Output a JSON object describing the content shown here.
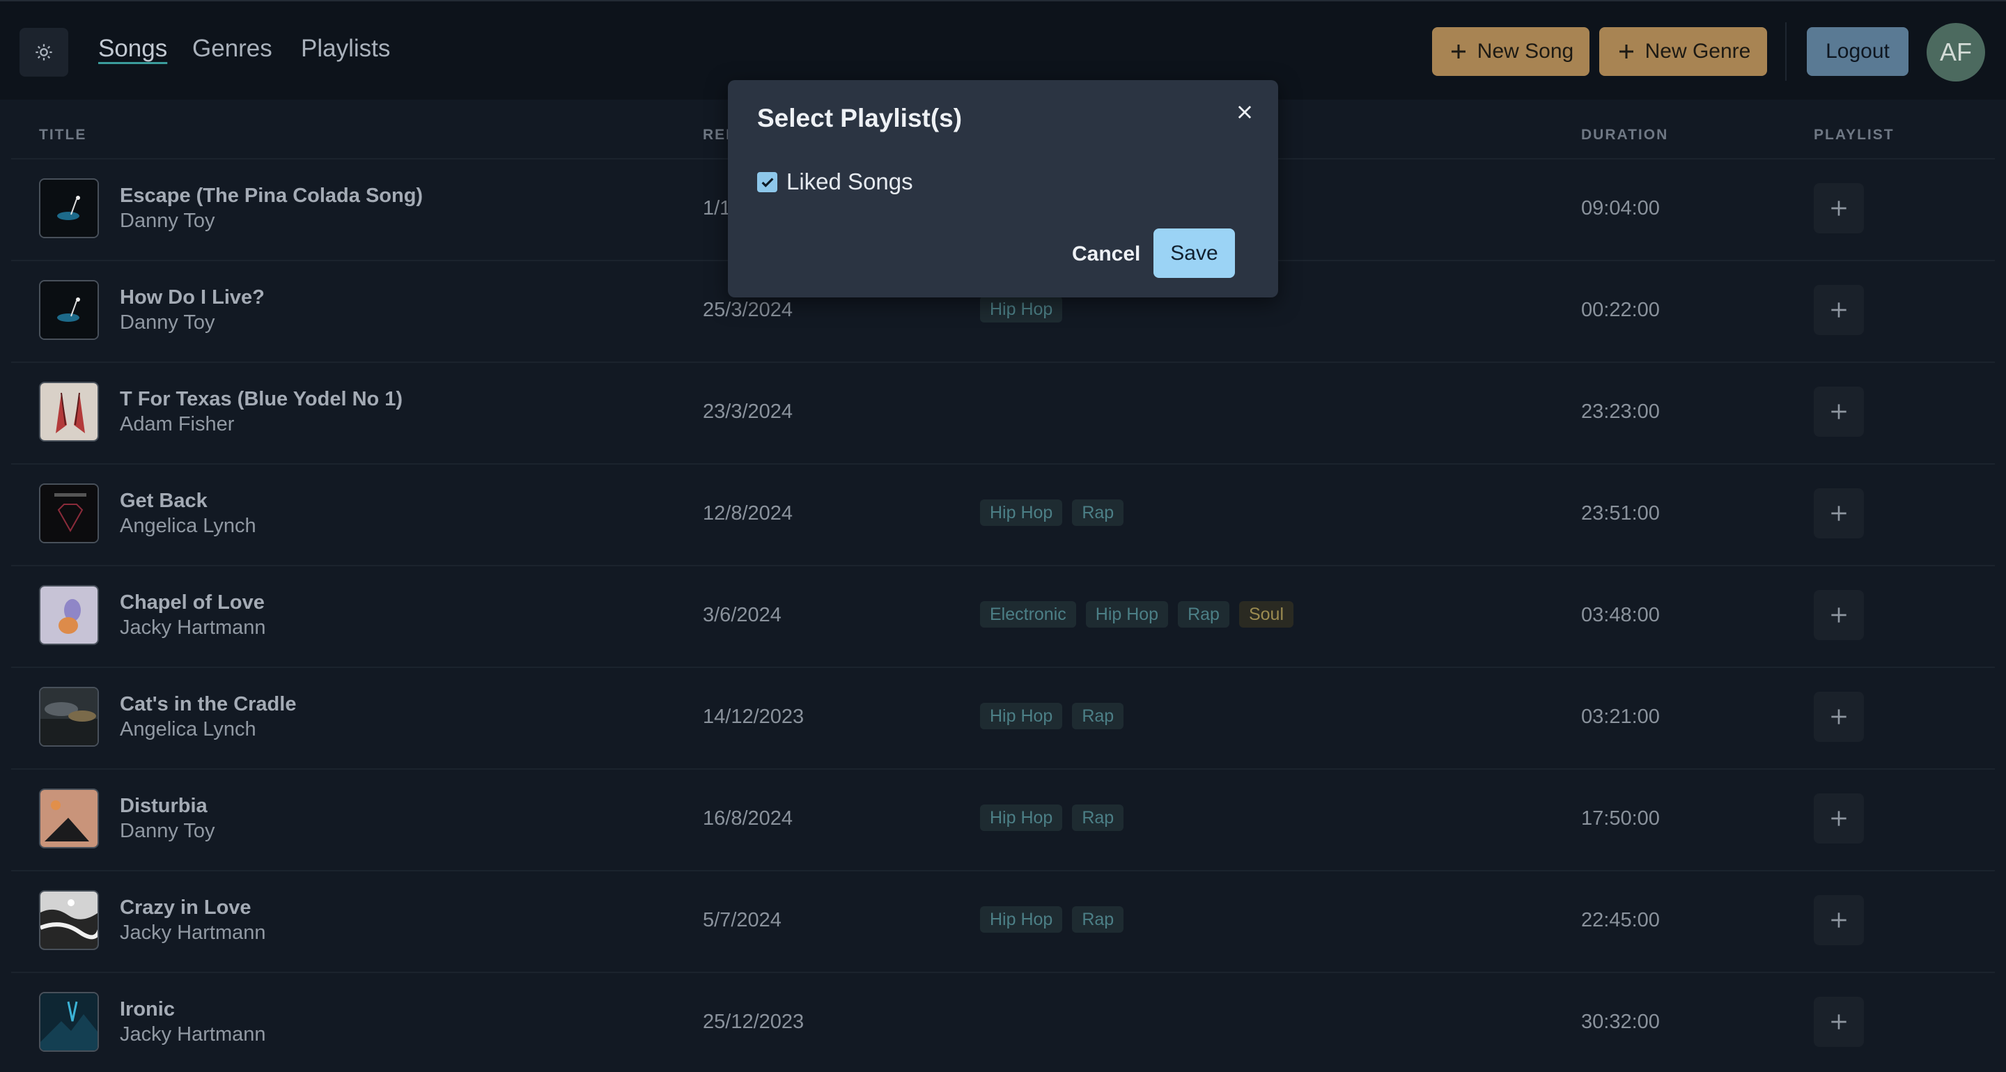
{
  "nav": {
    "theme_icon": "sun-icon",
    "links": [
      "Songs",
      "Genres",
      "Playlists"
    ],
    "active": "Songs"
  },
  "actions": {
    "new_song": "New Song",
    "new_genre": "New Genre",
    "logout": "Logout",
    "avatar_initials": "AF"
  },
  "columns": {
    "title": "TITLE",
    "release": "REL",
    "duration": "DURATION",
    "playlist": "PLAYLIST"
  },
  "songs": [
    {
      "title": "Escape (The Pina Colada Song)",
      "artist": "Danny Toy",
      "release": "1/1",
      "genres": [],
      "duration": "09:04:00"
    },
    {
      "title": "How Do I Live?",
      "artist": "Danny Toy",
      "release": "25/3/2024",
      "genres": [
        "Hip Hop"
      ],
      "duration": "00:22:00"
    },
    {
      "title": "T For Texas (Blue Yodel No 1)",
      "artist": "Adam Fisher",
      "release": "23/3/2024",
      "genres": [],
      "duration": "23:23:00"
    },
    {
      "title": "Get Back",
      "artist": "Angelica Lynch",
      "release": "12/8/2024",
      "genres": [
        "Hip Hop",
        "Rap"
      ],
      "duration": "23:51:00"
    },
    {
      "title": "Chapel of Love",
      "artist": "Jacky Hartmann",
      "release": "3/6/2024",
      "genres": [
        "Electronic",
        "Hip Hop",
        "Rap",
        "Soul"
      ],
      "duration": "03:48:00"
    },
    {
      "title": "Cat's in the Cradle",
      "artist": "Angelica Lynch",
      "release": "14/12/2023",
      "genres": [
        "Hip Hop",
        "Rap"
      ],
      "duration": "03:21:00"
    },
    {
      "title": "Disturbia",
      "artist": "Danny Toy",
      "release": "16/8/2024",
      "genres": [
        "Hip Hop",
        "Rap"
      ],
      "duration": "17:50:00"
    },
    {
      "title": "Crazy in Love",
      "artist": "Jacky Hartmann",
      "release": "5/7/2024",
      "genres": [
        "Hip Hop",
        "Rap"
      ],
      "duration": "22:45:00"
    },
    {
      "title": "Ironic",
      "artist": "Jacky Hartmann",
      "release": "25/12/2023",
      "genres": [],
      "duration": "30:32:00"
    }
  ],
  "modal": {
    "title": "Select Playlist(s)",
    "option_label": "Liked Songs",
    "option_checked": true,
    "cancel": "Cancel",
    "save": "Save"
  },
  "colors": {
    "accent_gold": "#a88453",
    "accent_blue": "#9bd3f5",
    "tag_teal": "#4c7f86",
    "tag_soul": "#9b8b50"
  }
}
